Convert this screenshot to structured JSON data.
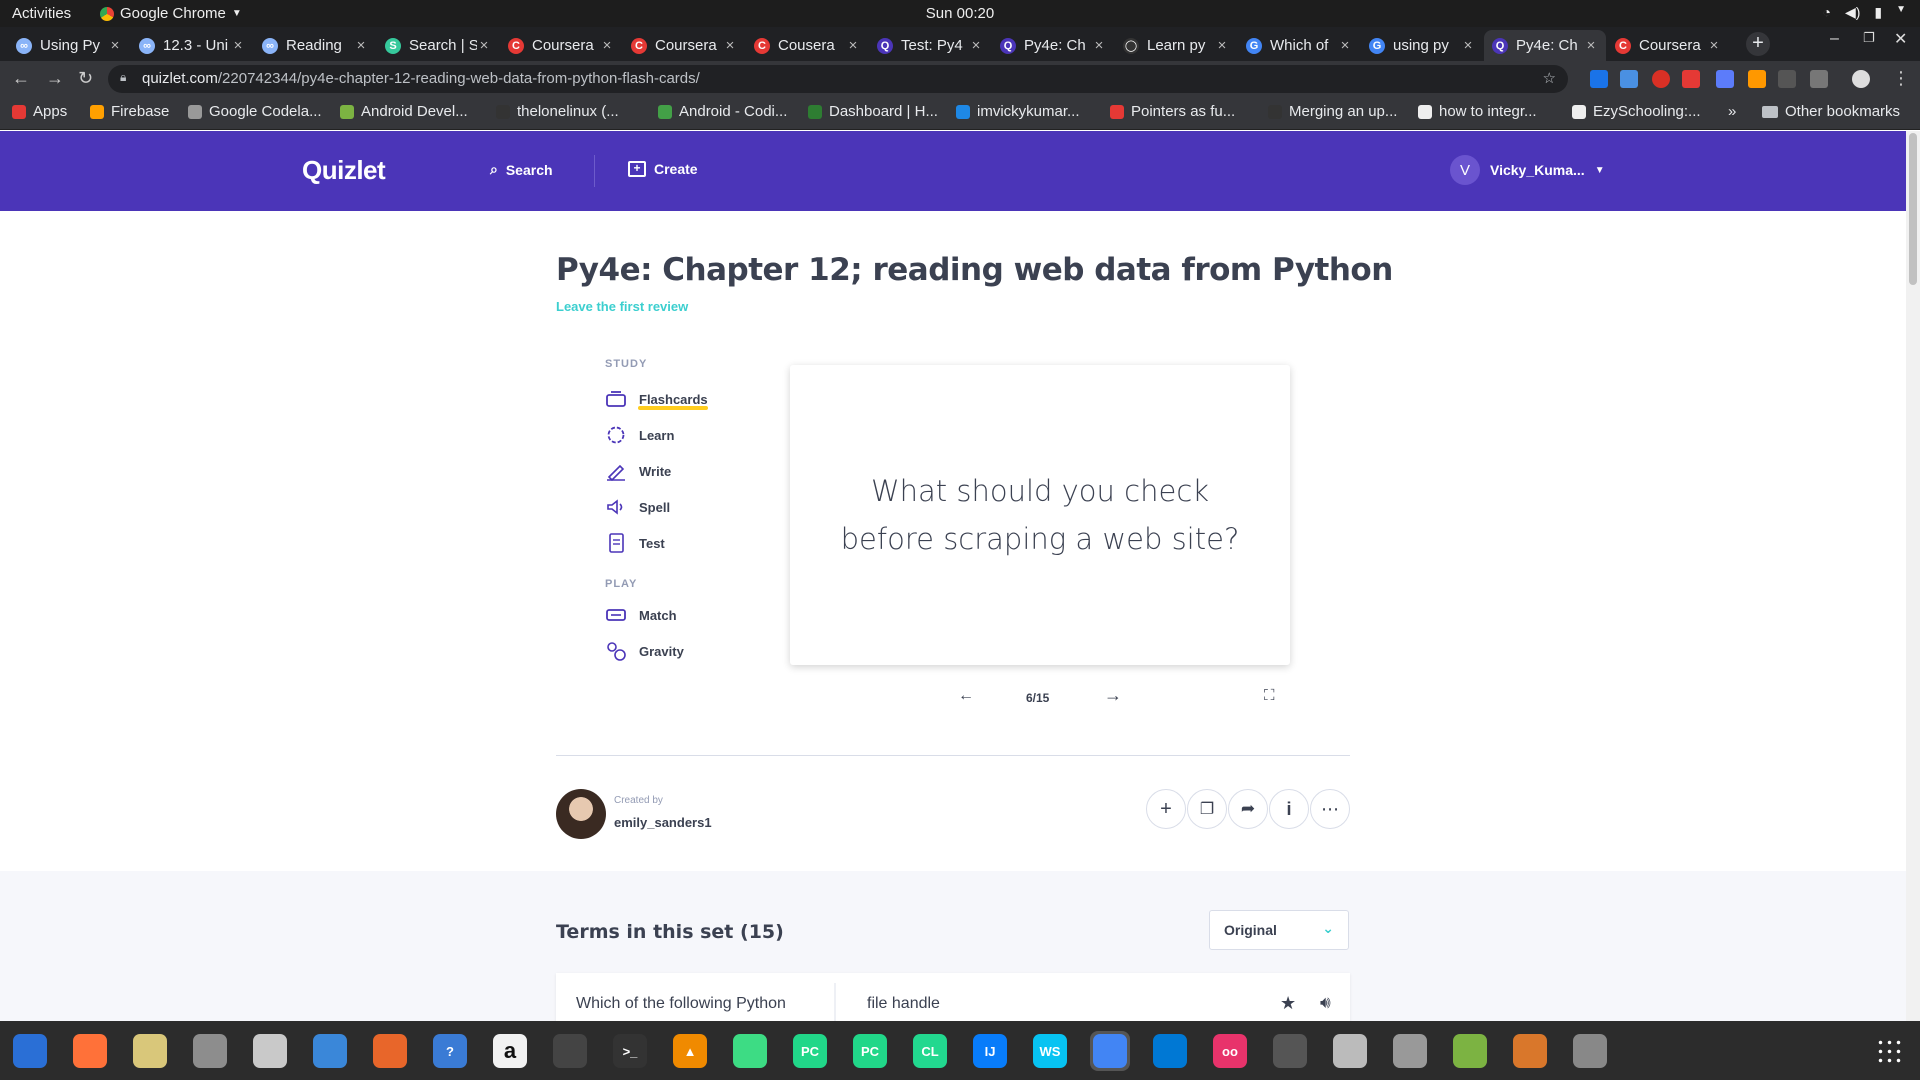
{
  "system": {
    "activities": "Activities",
    "app_name": "Google Chrome",
    "clock": "Sun 00:20"
  },
  "tabs": [
    {
      "title": "Using Py",
      "icon": "coursera-infinity-icon",
      "color": "#8ab4f8"
    },
    {
      "title": "12.3 - Uni",
      "icon": "coursera-infinity-icon",
      "color": "#8ab4f8"
    },
    {
      "title": "Reading",
      "icon": "coursera-infinity-icon",
      "color": "#8ab4f8"
    },
    {
      "title": "Search | S",
      "icon": "s-icon",
      "color": "#36c99c"
    },
    {
      "title": "Coursera",
      "icon": "coursera-c-icon",
      "color": "#e53935"
    },
    {
      "title": "Coursera",
      "icon": "coursera-c-icon",
      "color": "#e53935"
    },
    {
      "title": "Cousera",
      "icon": "coursera-c-icon",
      "color": "#e53935"
    },
    {
      "title": "Test: Py4",
      "icon": "quizlet-q-icon",
      "color": "#4b35b8"
    },
    {
      "title": "Py4e: Ch",
      "icon": "quizlet-q-icon",
      "color": "#4b35b8"
    },
    {
      "title": "Learn py",
      "icon": "github-icon",
      "color": "#333"
    },
    {
      "title": "Which of",
      "icon": "google-g-icon",
      "color": "#4285f4"
    },
    {
      "title": "using py",
      "icon": "google-g-icon",
      "color": "#4285f4"
    },
    {
      "title": "Py4e: Ch",
      "icon": "quizlet-q-icon",
      "color": "#4b35b8",
      "active": true
    },
    {
      "title": "Coursera",
      "icon": "coursera-c-icon",
      "color": "#e53935"
    }
  ],
  "omnibox": {
    "host": "quizlet.com",
    "path": "/220742344/py4e-chapter-12-reading-web-data-from-python-flash-cards/"
  },
  "bookmarks": [
    {
      "label": "Apps",
      "color": "#e53935"
    },
    {
      "label": "Firebase",
      "color": "#ffa000"
    },
    {
      "label": "Google Codela...",
      "color": "#999"
    },
    {
      "label": "Android Devel...",
      "color": "#7cb342"
    },
    {
      "label": "thelonelinux (...",
      "color": "#333"
    },
    {
      "label": "Android - Codi...",
      "color": "#43a047"
    },
    {
      "label": "Dashboard | H...",
      "color": "#2e7d32"
    },
    {
      "label": "imvickykumar...",
      "color": "#1e88e5"
    },
    {
      "label": "Pointers as fu...",
      "color": "#e53935"
    },
    {
      "label": "Merging an up...",
      "color": "#333"
    },
    {
      "label": "how to integr...",
      "color": "#eee"
    },
    {
      "label": "EzySchooling:...",
      "color": "#eee"
    }
  ],
  "bookmarks_more": "»",
  "other_bookmarks": "Other bookmarks",
  "quizlet": {
    "logo": "Quizlet",
    "search": "Search",
    "create": "Create",
    "user_initial": "V",
    "username": "Vicky_Kuma...",
    "set_title": "Py4e: Chapter 12; reading web data from Python",
    "review_link": "Leave the first review",
    "study_label": "STUDY",
    "study_modes": [
      "Flashcards",
      "Learn",
      "Write",
      "Spell",
      "Test"
    ],
    "play_label": "PLAY",
    "play_modes": [
      "Match",
      "Gravity"
    ],
    "card_text": "What should you check before scraping a web site?",
    "counter": "6/15",
    "created_by_label": "Created by",
    "creator": "emily_sanders1",
    "terms_heading": "Terms in this set (15)",
    "sort_value": "Original",
    "term_row": {
      "term": "Which of the following Python",
      "definition": "file handle"
    }
  },
  "colors": {
    "brand": "#4b35b8",
    "accent": "#3ccfcf",
    "highlight": "#ffcd1f"
  },
  "dock": [
    {
      "name": "thunderbird-icon",
      "color": "#2a6fd6"
    },
    {
      "name": "firefox-icon",
      "color": "#ff7139"
    },
    {
      "name": "rhythmbox-icon",
      "color": "#d9c77a"
    },
    {
      "name": "files-icon",
      "color": "#8d8d8d"
    },
    {
      "name": "text-editor-icon",
      "color": "#c9c9c9"
    },
    {
      "name": "writer-icon",
      "color": "#3a87d9"
    },
    {
      "name": "software-center-icon",
      "color": "#e8662a"
    },
    {
      "name": "help-icon",
      "color": "#3a7bd5"
    },
    {
      "name": "amazon-icon",
      "color": "#f2f2f2"
    },
    {
      "name": "video-editor-icon",
      "color": "#444"
    },
    {
      "name": "terminal-icon",
      "color": "#333"
    },
    {
      "name": "vlc-icon",
      "color": "#f08a00"
    },
    {
      "name": "android-studio-icon",
      "color": "#3ddc84"
    },
    {
      "name": "pycharm-icon",
      "color": "#21d789"
    },
    {
      "name": "pycharm-pro-icon",
      "color": "#21d789"
    },
    {
      "name": "clion-icon",
      "color": "#22d88f"
    },
    {
      "name": "intellij-icon",
      "color": "#087cfa"
    },
    {
      "name": "webstorm-icon",
      "color": "#07c3f2"
    },
    {
      "name": "chrome-icon",
      "color": "#4285f4",
      "active": true
    },
    {
      "name": "vscode-icon",
      "color": "#0078d4"
    },
    {
      "name": "flickr-icon",
      "color": "#e8336b"
    },
    {
      "name": "color-picker-icon",
      "color": "#555"
    },
    {
      "name": "printer-icon",
      "color": "#bbb"
    },
    {
      "name": "scanner-icon",
      "color": "#999"
    },
    {
      "name": "image-viewer-icon",
      "color": "#7cb342"
    },
    {
      "name": "archive-icon",
      "color": "#d9772b"
    },
    {
      "name": "webcam-icon",
      "color": "#888"
    }
  ],
  "dock_labels": {
    "pycharm": "PC",
    "pycharm_pro": "PC",
    "clion": "CL",
    "intellij": "IJ",
    "webstorm": "WS",
    "terminal": ">_",
    "help": "?",
    "amazon": "a"
  }
}
